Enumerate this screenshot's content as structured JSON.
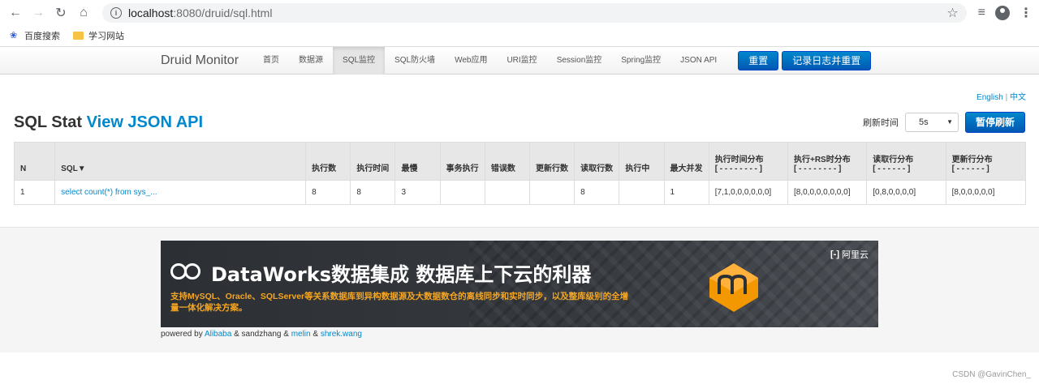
{
  "browser": {
    "url_host": "localhost",
    "url_path": ":8080/druid/sql.html",
    "bookmarks": [
      "百度搜索",
      "学习网站"
    ]
  },
  "nav": {
    "brand": "Druid Monitor",
    "items": [
      "首页",
      "数据源",
      "SQL监控",
      "SQL防火墙",
      "Web应用",
      "URI监控",
      "Session监控",
      "Spring监控",
      "JSON API"
    ],
    "reset_label": "重置",
    "log_reset_label": "记录日志并重置"
  },
  "lang": {
    "english": "English",
    "sep": " | ",
    "chinese": "中文"
  },
  "title": {
    "main": "SQL Stat ",
    "link": "View JSON API"
  },
  "refresh": {
    "label": "刷新时间",
    "value": "5s",
    "pause_label": "暂停刷新"
  },
  "table": {
    "headers": [
      "N",
      "SQL▼",
      "执行数",
      "执行时间",
      "最慢",
      "事务执行",
      "错误数",
      "更新行数",
      "读取行数",
      "执行中",
      "最大并发"
    ],
    "dist_headers": [
      {
        "label": "执行时间分布",
        "dash": "[ - - - - - - - - ]"
      },
      {
        "label": "执行+RS时分布",
        "dash": "[ - - - - - - - - ]"
      },
      {
        "label": "读取行分布",
        "dash": "[ - - - - - - ]"
      },
      {
        "label": "更新行分布",
        "dash": "[ - - - - - - ]"
      }
    ],
    "rows": [
      [
        "1",
        "select count(*) from sys_...",
        "8",
        "8",
        "3",
        "",
        "",
        "",
        "8",
        "",
        "1",
        "[7,1,0,0,0,0,0,0]",
        "[8,0,0,0,0,0,0,0]",
        "[0,8,0,0,0,0]",
        "[8,0,0,0,0,0]"
      ]
    ]
  },
  "banner": {
    "title": "DataWorks数据集成 数据库上下云的利器",
    "subtitle": "支持MySQL、Oracle、SQLServer等关系数据库到异构数据源及大数据数仓的离线同步和实时同步，以及整库级别的全增量一体化解决方案。",
    "aliyun": "阿里云"
  },
  "powered": {
    "prefix": "powered by ",
    "alibaba": "Alibaba",
    "amp1": " & sandzhang & ",
    "melin": "melin",
    "amp2": " & ",
    "shrek": "shrek.wang"
  },
  "watermark": "CSDN @GavinChen_",
  "colors": {
    "link": "#0088cc",
    "button": "#0066cc",
    "banner_accent": "#f5a623"
  }
}
